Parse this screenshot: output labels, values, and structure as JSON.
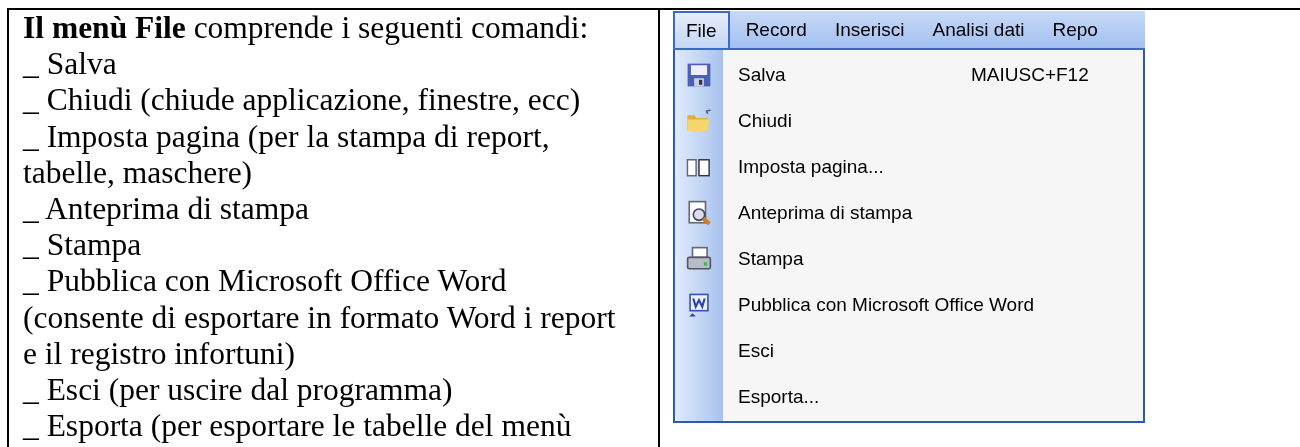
{
  "description": {
    "intro": "**Il menù File** comprende i seguenti comandi:",
    "items": [
      "_ Salva",
      "_ Chiudi (chiude applicazione, finestre, ecc)",
      "_ Imposta pagina (per la stampa di report, tabelle, maschere)",
      "_ Anteprima di stampa",
      "_ Stampa",
      "_ Pubblica con Microsoft Office Word (consente di esportare in formato Word i report e il registro infortuni)",
      "_ Esci (per uscire dal programma)",
      "_ Esporta (per esportare le tabelle del menù"
    ]
  },
  "screenshot": {
    "menu_bar": [
      {
        "label": "File",
        "selected": true
      },
      {
        "label": "Record",
        "selected": false
      },
      {
        "label": "Inserisci",
        "selected": false
      },
      {
        "label": "Analisi dati",
        "selected": false
      },
      {
        "label": "Repo",
        "selected": false
      }
    ],
    "menu_items": [
      {
        "label": "Salva",
        "shortcut": "MAIUSC+F12"
      },
      {
        "label": "Chiudi"
      },
      {
        "label": "Imposta pagina..."
      },
      {
        "label": "Anteprima di stampa"
      },
      {
        "label": "Stampa"
      },
      {
        "label": "Pubblica con Microsoft Office Word"
      },
      {
        "label": "Esci"
      },
      {
        "label": "Esporta..."
      }
    ]
  }
}
